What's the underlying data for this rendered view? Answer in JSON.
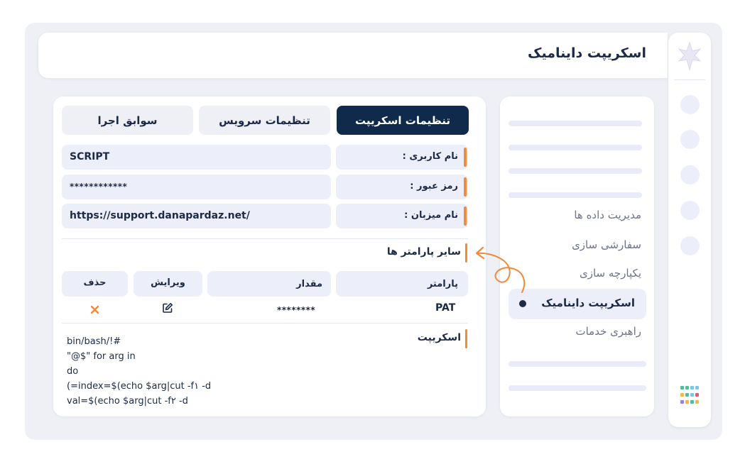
{
  "header": {
    "title": "اسکریپت داینامیک"
  },
  "sidebar": {
    "items": [
      {
        "label": "مدیریت داده ها"
      },
      {
        "label": "سفارشی سازی"
      },
      {
        "label": "یکپارچه سازی"
      },
      {
        "label": "اسکریپت داینامیک",
        "active": true
      },
      {
        "label": "راهبری خدمات"
      }
    ]
  },
  "tabs": [
    {
      "label": "تنظیمات اسکریپت",
      "active": true
    },
    {
      "label": "تنظیمات سرویس"
    },
    {
      "label": "سوابق اجرا"
    }
  ],
  "fields": [
    {
      "label": "نام کاربری :",
      "value": "SCRIPT"
    },
    {
      "label": "رمز عبور :",
      "value": "************"
    },
    {
      "label": "نام میزبان :",
      "value": "https://support.danapardaz.net/"
    }
  ],
  "params": {
    "title": "سایر پارامتر ها",
    "columns": {
      "param": "پارامتر",
      "value": "مقدار",
      "edit": "ویرایش",
      "delete": "حذف"
    },
    "rows": [
      {
        "param": "PAT",
        "value": "********"
      }
    ]
  },
  "script": {
    "title": "اسکریپت",
    "lines": [
      "bin/bash/!#",
      "\"@$\" for arg in",
      "do",
      "(=index=$(echo $arg|cut -f۱ -d",
      "val=$(echo $arg|cut -f۲ -d"
    ]
  },
  "colors": {
    "accent": "#f08a3c",
    "primary": "#0f2a4a",
    "surface": "#eceef9"
  },
  "icons": {
    "edit": "edit-icon",
    "delete": "close-icon",
    "apps": "apps-grid-icon",
    "logo": "leaf-logo-icon"
  }
}
